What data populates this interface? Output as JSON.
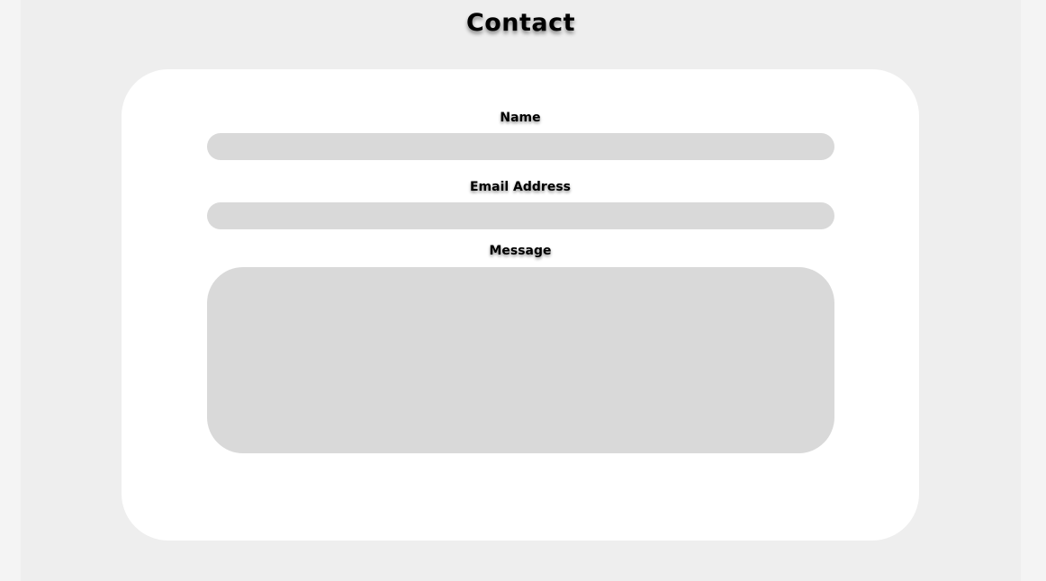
{
  "page": {
    "title": "Contact"
  },
  "form": {
    "name_label": "Name",
    "name_value": "",
    "email_label": "Email Address",
    "email_value": "",
    "message_label": "Message",
    "message_value": ""
  },
  "colors": {
    "outer_background": "#f4f4f4",
    "page_background": "#eeeeee",
    "card_background": "#ffffff",
    "input_background": "#d9d9d9",
    "text": "#000000"
  }
}
